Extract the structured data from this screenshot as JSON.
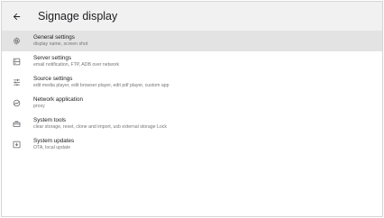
{
  "appbar": {
    "title": "Signage display"
  },
  "items": [
    {
      "icon": "gear-icon",
      "title": "General settings",
      "subtitle": "display name, screen shot",
      "selected": true
    },
    {
      "icon": "server-icon",
      "title": "Server settings",
      "subtitle": "email notification, FTP, ADB over network",
      "selected": false
    },
    {
      "icon": "sliders-icon",
      "title": "Source settings",
      "subtitle": "edit media player, edit browser player, edit pdf player, custom app",
      "selected": false
    },
    {
      "icon": "network-icon",
      "title": "Network application",
      "subtitle": "proxy",
      "selected": false
    },
    {
      "icon": "toolbox-icon",
      "title": "System tools",
      "subtitle": "clear storage, reset, clone and import, usb external storage Lock",
      "selected": false
    },
    {
      "icon": "system-update-icon",
      "title": "System updates",
      "subtitle": "OTA, local update",
      "selected": false
    }
  ]
}
